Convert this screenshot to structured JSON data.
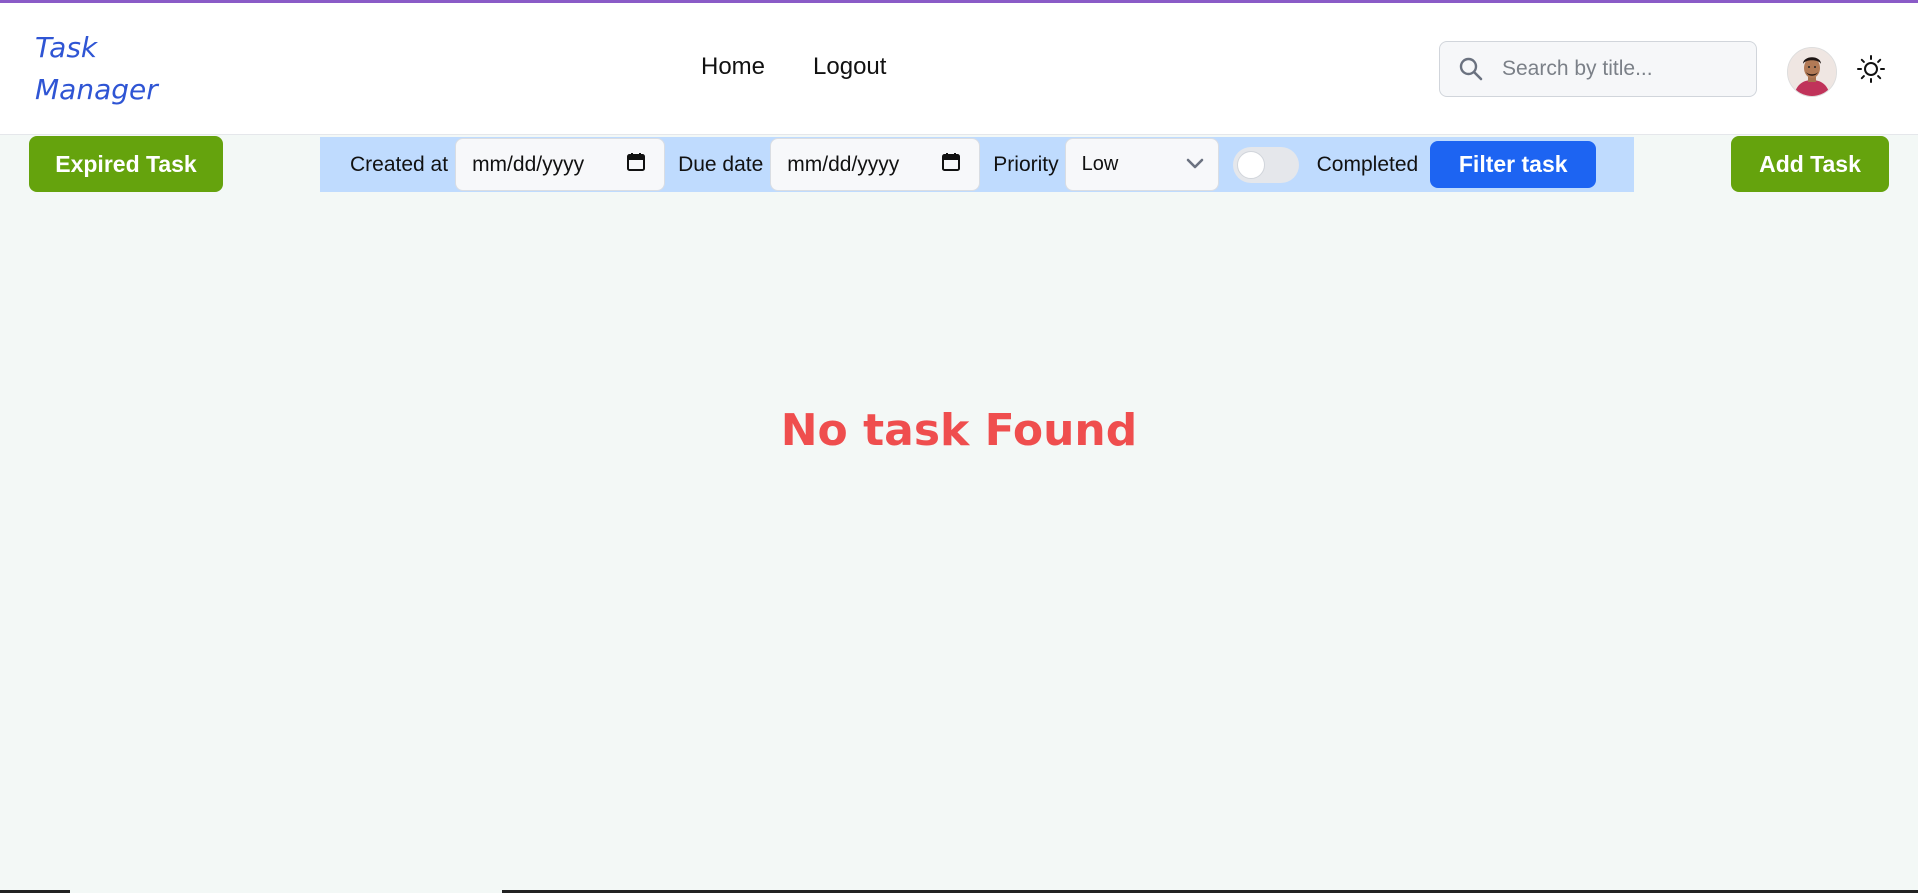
{
  "app": {
    "logo_line1": "Task",
    "logo_line2": "Manager"
  },
  "nav": {
    "home": "Home",
    "logout": "Logout"
  },
  "search": {
    "placeholder": "Search by title...",
    "value": ""
  },
  "actions": {
    "expired_label": "Expired Task",
    "add_label": "Add Task"
  },
  "filters": {
    "created_label": "Created at",
    "created_value": "mm/dd/yyyy",
    "due_label": "Due date",
    "due_value": "mm/dd/yyyy",
    "priority_label": "Priority",
    "priority_value": "Low",
    "completed_label": "Completed",
    "completed_on": false,
    "filter_button": "Filter task"
  },
  "main": {
    "empty_message": "No task Found"
  },
  "colors": {
    "accent_purple": "#8a5bc7",
    "logo_blue": "#2f55d4",
    "green_button": "#65a30d",
    "filter_bar": "#bfdbfe",
    "primary_blue": "#1d64f2",
    "empty_red": "#ef4e4e"
  },
  "icons": {
    "search": "search-icon",
    "calendar": "calendar-icon",
    "chevron": "chevron-down-icon",
    "theme": "sun-icon"
  }
}
